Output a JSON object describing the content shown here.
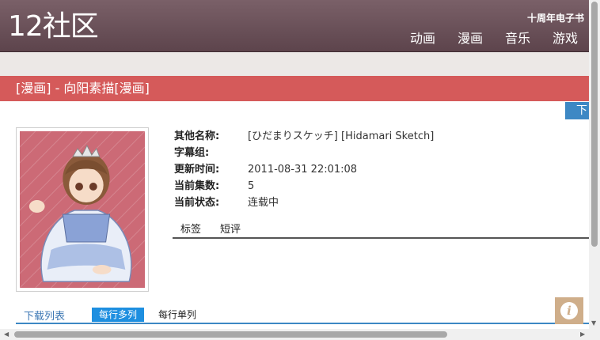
{
  "header": {
    "logo": "12社区",
    "top_link": "十周年电子书",
    "nav": [
      "动画",
      "漫画",
      "音乐",
      "游戏"
    ]
  },
  "title_bar": {
    "text": "[漫画] - 向阳素描[漫画]"
  },
  "download_tab": {
    "label": "下"
  },
  "info": {
    "rows": [
      {
        "label": "其他名称:",
        "value": "[ひだまりスケッチ] [Hidamari Sketch]"
      },
      {
        "label": "字幕组:",
        "value": ""
      },
      {
        "label": "更新时间:",
        "value": "2011-08-31 22:01:08"
      },
      {
        "label": "当前集数:",
        "value": "5"
      },
      {
        "label": "当前状态:",
        "value": "连载中"
      }
    ],
    "tabs": [
      "标签",
      "短评"
    ]
  },
  "download_list": {
    "title": "下载列表",
    "multi_label": "每行多列",
    "single_label": "每行单列"
  },
  "info_button": {
    "glyph": "i"
  },
  "colors": {
    "header": "#6b5058",
    "title_bar": "#d55a5a",
    "accent_blue": "#1e8fe0",
    "info_button": "#cfae8a"
  }
}
